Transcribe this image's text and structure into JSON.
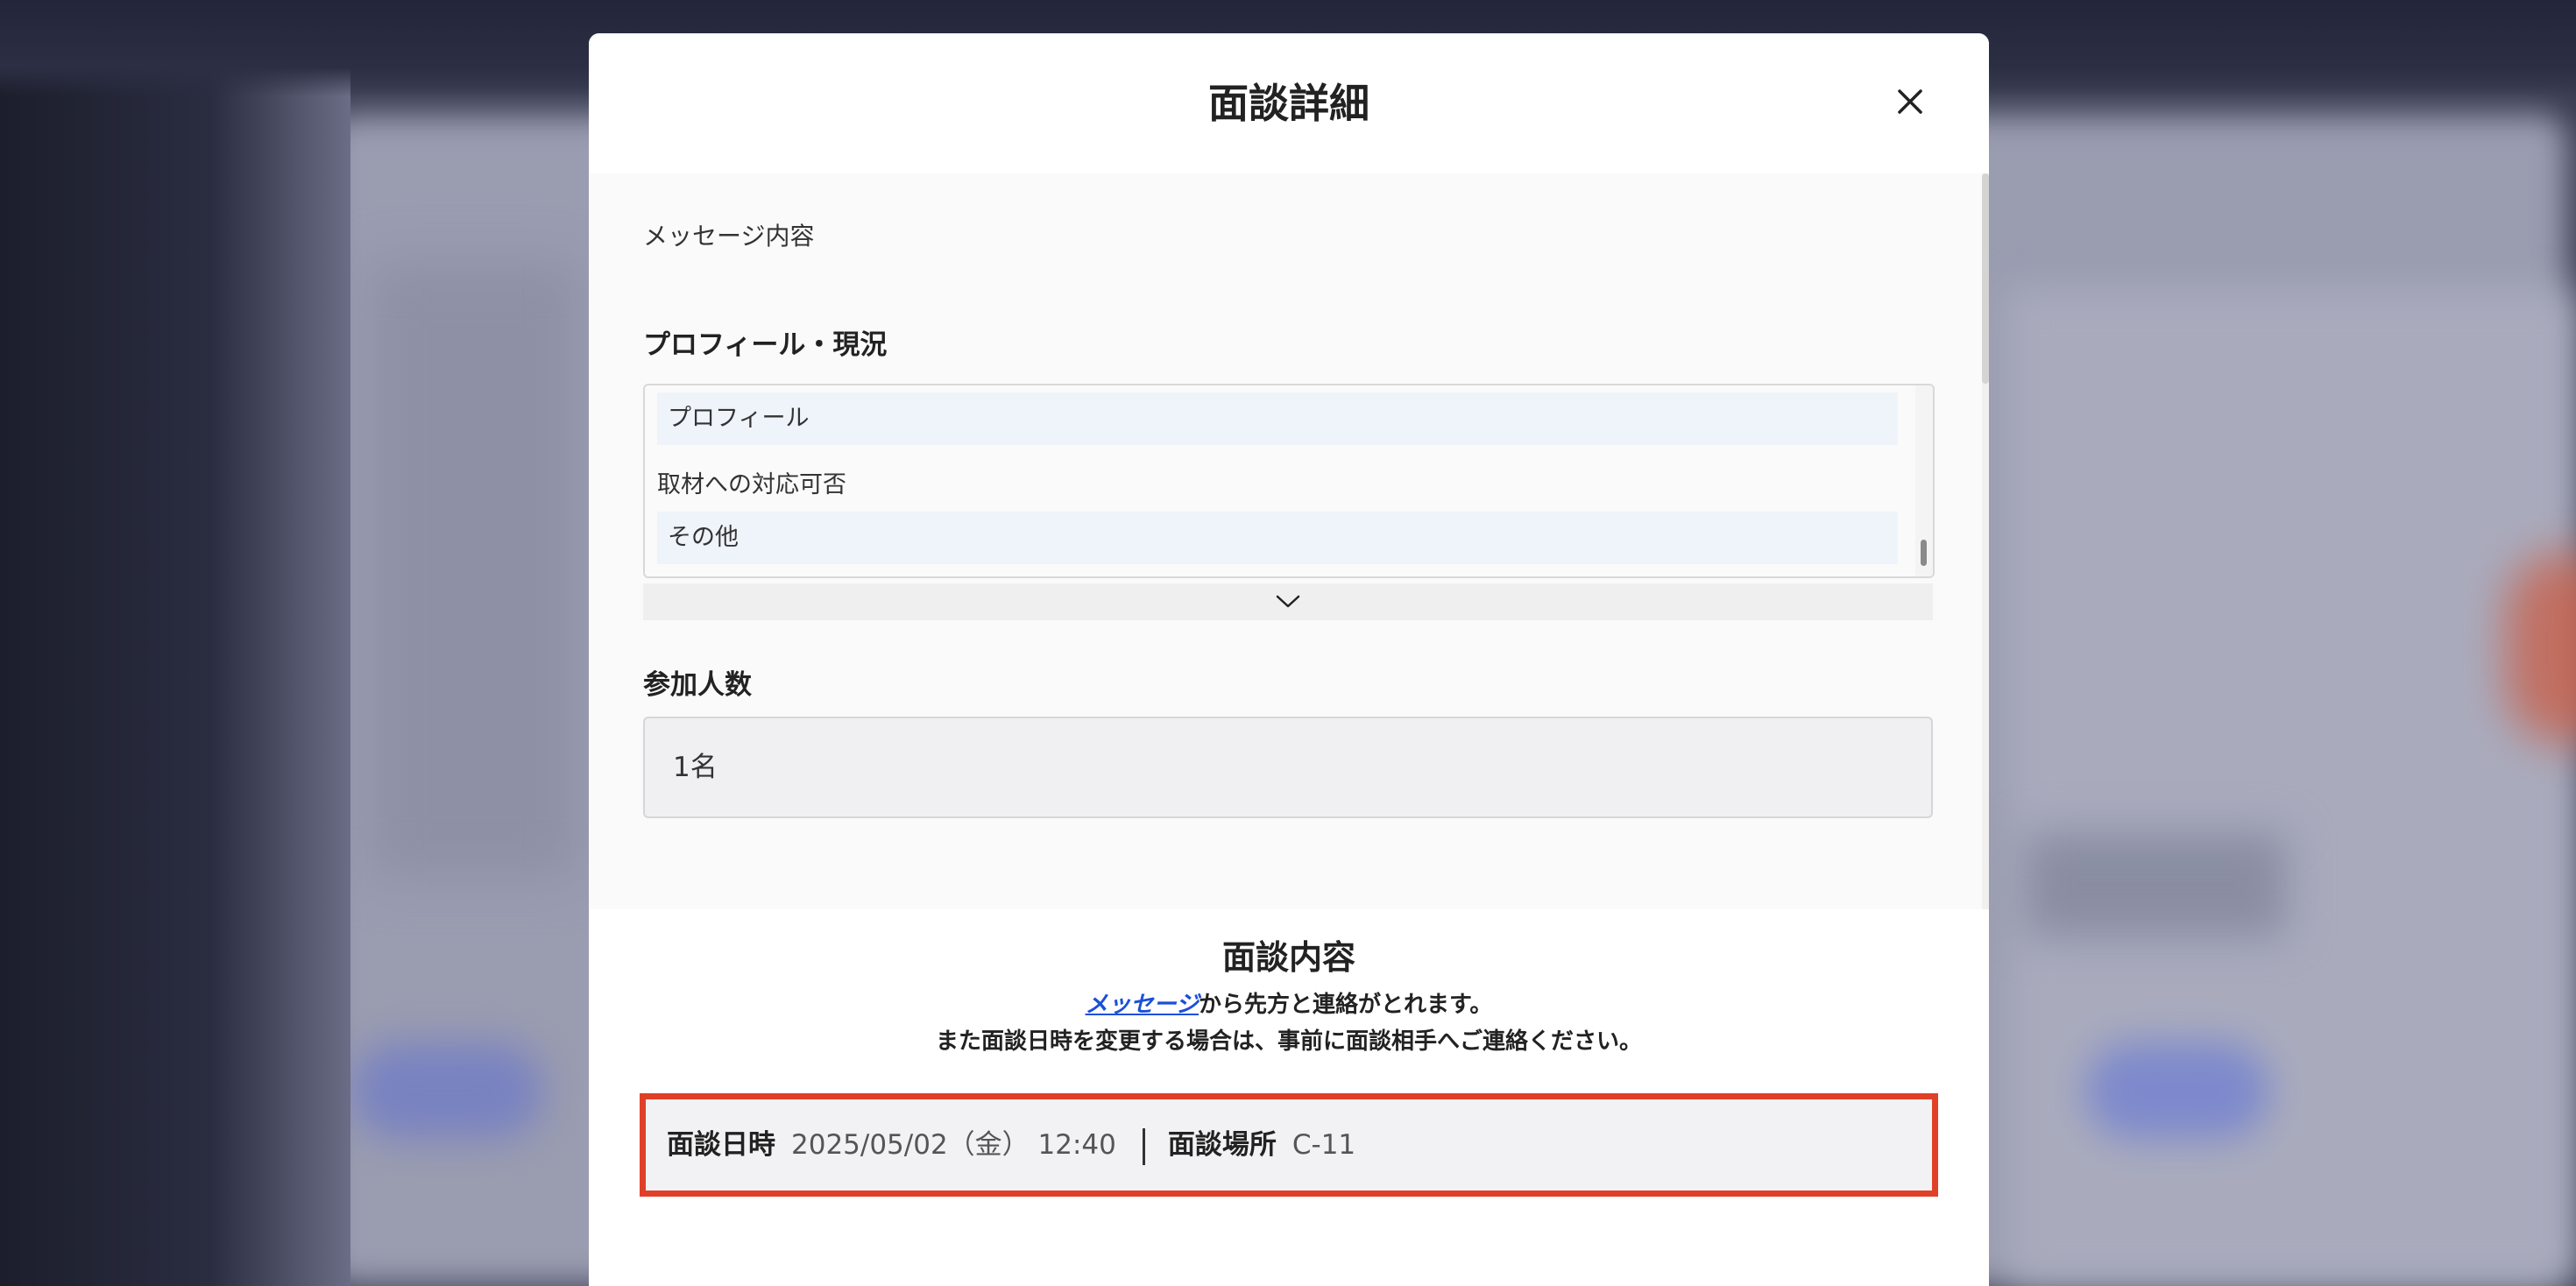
{
  "modal": {
    "title": "面談詳細",
    "close_icon": "close-icon"
  },
  "message": {
    "label": "メッセージ内容"
  },
  "profile": {
    "heading": "プロフィール・現況",
    "items": [
      {
        "label": "プロフィール"
      },
      {
        "label": "取材への対応可否"
      },
      {
        "label": "その他"
      }
    ],
    "expand_icon": "chevron-down-icon"
  },
  "participants": {
    "heading": "参加人数",
    "value": "1名"
  },
  "interview_content": {
    "title": "面談内容",
    "line1_link": "メッセージ",
    "line1_rest": "から先方と連絡がとれます。",
    "line2": "また面談日時を変更する場合は、事前に面談相手へご連絡ください。"
  },
  "details": {
    "datetime_label": "面談日時",
    "datetime_value": "2025/05/02（金） 12:40",
    "location_label": "面談場所",
    "location_value": "C-11",
    "highlight_color": "#e04028"
  }
}
